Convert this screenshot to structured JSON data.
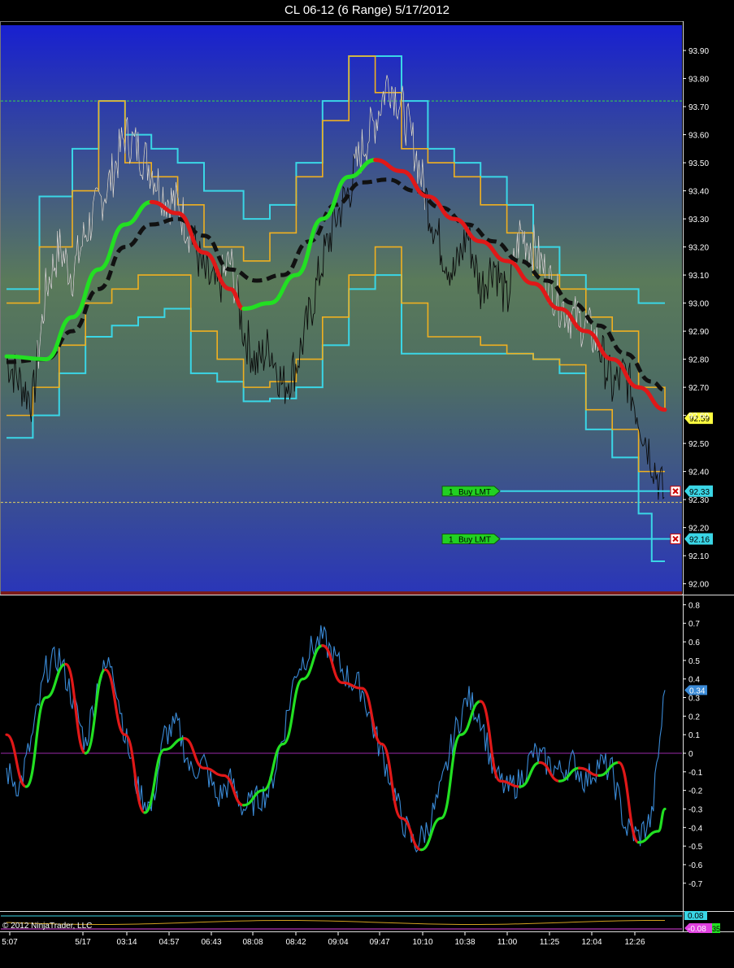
{
  "title": "CL 06-12 (6 Range)  5/17/2012",
  "copyright": "© 2012 NinjaTrader, LLC",
  "colors": {
    "price_bg_top": "#1a22c8",
    "price_bg_mid": "#5a7a5a",
    "price_bg_bottom": "#2a3aa8",
    "price_bars": "#0a0a0a",
    "price_bars_high": "#ffffff",
    "channel_outer": "#3ad6e6",
    "channel_inner": "#f0b020",
    "ma_up": "#22e022",
    "ma_down": "#e01818",
    "ma_slow": "#111111",
    "osc_fast": "#3a8ad6",
    "osc_up": "#22e022",
    "osc_down": "#e01818",
    "zero_line": "#9a2aa8",
    "order_line": "#3ad6e6",
    "order_tag": "#22d022",
    "last_price_tag": "#ffff40",
    "grid_text": "#ffffff"
  },
  "chart_data": [
    {
      "panel": "price",
      "type": "line",
      "instrument": "CL 06-12",
      "bar_type": "6 Range",
      "y_ticks": [
        "93.90",
        "93.80",
        "93.70",
        "93.60",
        "93.50",
        "93.40",
        "93.30",
        "93.20",
        "93.10",
        "93.00",
        "92.90",
        "92.80",
        "92.70",
        "92.60",
        "92.50",
        "92.40",
        "92.30",
        "92.20",
        "92.10",
        "92.00"
      ],
      "ylim": [
        91.97,
        93.99
      ],
      "reference_lines": [
        {
          "value": 93.72,
          "style": "dashed",
          "color": "#3ad64a"
        },
        {
          "value": 92.29,
          "style": "dashed",
          "color": "#e0d060"
        }
      ],
      "last_price": "92.59",
      "price_close": [
        [
          0,
          92.8
        ],
        [
          2,
          92.72
        ],
        [
          4,
          92.65
        ],
        [
          6,
          93.05
        ],
        [
          8,
          93.2
        ],
        [
          10,
          93.1
        ],
        [
          12,
          93.25
        ],
        [
          14,
          93.35
        ],
        [
          16,
          93.45
        ],
        [
          18,
          93.6
        ],
        [
          20,
          93.55
        ],
        [
          22,
          93.48
        ],
        [
          24,
          93.38
        ],
        [
          26,
          93.35
        ],
        [
          28,
          93.25
        ],
        [
          30,
          93.1
        ],
        [
          32,
          93.05
        ],
        [
          34,
          93.15
        ],
        [
          36,
          92.9
        ],
        [
          38,
          92.78
        ],
        [
          40,
          92.85
        ],
        [
          42,
          92.7
        ],
        [
          44,
          92.78
        ],
        [
          46,
          92.95
        ],
        [
          48,
          93.15
        ],
        [
          50,
          93.3
        ],
        [
          52,
          93.4
        ],
        [
          54,
          93.55
        ],
        [
          56,
          93.65
        ],
        [
          58,
          93.8
        ],
        [
          60,
          93.7
        ],
        [
          62,
          93.55
        ],
        [
          64,
          93.35
        ],
        [
          66,
          93.2
        ],
        [
          68,
          93.1
        ],
        [
          70,
          93.25
        ],
        [
          72,
          93.05
        ],
        [
          74,
          93.15
        ],
        [
          76,
          93.0
        ],
        [
          78,
          93.25
        ],
        [
          80,
          93.2
        ],
        [
          82,
          93.1
        ],
        [
          84,
          93.0
        ],
        [
          86,
          92.95
        ],
        [
          88,
          92.92
        ],
        [
          90,
          92.85
        ],
        [
          92,
          92.7
        ],
        [
          94,
          92.75
        ],
        [
          96,
          92.6
        ],
        [
          98,
          92.45
        ],
        [
          100,
          92.3
        ],
        [
          101,
          92.6
        ]
      ],
      "ma_fast": [
        [
          0,
          92.81
        ],
        [
          6,
          92.8
        ],
        [
          10,
          92.95
        ],
        [
          14,
          93.12
        ],
        [
          18,
          93.28
        ],
        [
          22,
          93.36
        ],
        [
          26,
          93.32
        ],
        [
          30,
          93.18
        ],
        [
          34,
          93.05
        ],
        [
          36,
          92.98
        ],
        [
          40,
          93.0
        ],
        [
          44,
          93.1
        ],
        [
          48,
          93.3
        ],
        [
          52,
          93.45
        ],
        [
          56,
          93.51
        ],
        [
          60,
          93.47
        ],
        [
          64,
          93.38
        ],
        [
          68,
          93.3
        ],
        [
          72,
          93.22
        ],
        [
          76,
          93.15
        ],
        [
          80,
          93.07
        ],
        [
          84,
          92.98
        ],
        [
          88,
          92.9
        ],
        [
          92,
          92.8
        ],
        [
          96,
          92.7
        ],
        [
          100,
          92.62
        ]
      ],
      "ma_fast_dir": [
        "down",
        "up",
        "up",
        "up",
        "up",
        "up",
        "down",
        "down",
        "down",
        "down",
        "up",
        "up",
        "up",
        "up",
        "up",
        "down",
        "down",
        "down",
        "down",
        "down",
        "down",
        "down",
        "down",
        "down",
        "down",
        "down"
      ],
      "ma_slow": [
        [
          0,
          92.79
        ],
        [
          6,
          92.8
        ],
        [
          10,
          92.9
        ],
        [
          14,
          93.05
        ],
        [
          18,
          93.2
        ],
        [
          22,
          93.28
        ],
        [
          26,
          93.3
        ],
        [
          30,
          93.24
        ],
        [
          34,
          93.12
        ],
        [
          38,
          93.08
        ],
        [
          42,
          93.1
        ],
        [
          46,
          93.22
        ],
        [
          50,
          93.35
        ],
        [
          54,
          93.43
        ],
        [
          58,
          93.44
        ],
        [
          62,
          93.4
        ],
        [
          66,
          93.34
        ],
        [
          70,
          93.28
        ],
        [
          74,
          93.22
        ],
        [
          78,
          93.15
        ],
        [
          82,
          93.08
        ],
        [
          86,
          93.0
        ],
        [
          90,
          92.92
        ],
        [
          94,
          92.82
        ],
        [
          98,
          92.72
        ],
        [
          100,
          92.69
        ]
      ],
      "channel_outer_upper": [
        [
          0,
          93.05
        ],
        [
          5,
          93.38
        ],
        [
          10,
          93.55
        ],
        [
          14,
          93.72
        ],
        [
          18,
          93.6
        ],
        [
          22,
          93.55
        ],
        [
          26,
          93.5
        ],
        [
          30,
          93.4
        ],
        [
          36,
          93.3
        ],
        [
          40,
          93.35
        ],
        [
          44,
          93.5
        ],
        [
          48,
          93.72
        ],
        [
          52,
          93.88
        ],
        [
          56,
          93.88
        ],
        [
          60,
          93.72
        ],
        [
          64,
          93.55
        ],
        [
          68,
          93.5
        ],
        [
          72,
          93.45
        ],
        [
          76,
          93.35
        ],
        [
          80,
          93.2
        ],
        [
          84,
          93.1
        ],
        [
          88,
          93.05
        ],
        [
          92,
          93.05
        ],
        [
          96,
          93.0
        ],
        [
          100,
          93.0
        ]
      ],
      "channel_outer_lower": [
        [
          0,
          92.52
        ],
        [
          4,
          92.6
        ],
        [
          8,
          92.75
        ],
        [
          12,
          92.88
        ],
        [
          16,
          92.92
        ],
        [
          20,
          92.95
        ],
        [
          24,
          92.98
        ],
        [
          28,
          92.75
        ],
        [
          32,
          92.72
        ],
        [
          36,
          92.65
        ],
        [
          40,
          92.66
        ],
        [
          44,
          92.7
        ],
        [
          48,
          92.85
        ],
        [
          52,
          93.05
        ],
        [
          56,
          93.1
        ],
        [
          60,
          92.82
        ],
        [
          64,
          92.82
        ],
        [
          68,
          92.82
        ],
        [
          72,
          92.82
        ],
        [
          76,
          92.82
        ],
        [
          80,
          92.8
        ],
        [
          84,
          92.75
        ],
        [
          88,
          92.55
        ],
        [
          92,
          92.45
        ],
        [
          96,
          92.25
        ],
        [
          98,
          92.08
        ],
        [
          100,
          92.08
        ]
      ],
      "channel_inner_upper": [
        [
          0,
          93.0
        ],
        [
          5,
          93.2
        ],
        [
          10,
          93.4
        ],
        [
          14,
          93.72
        ],
        [
          18,
          93.5
        ],
        [
          22,
          93.45
        ],
        [
          26,
          93.35
        ],
        [
          30,
          93.2
        ],
        [
          36,
          93.15
        ],
        [
          40,
          93.25
        ],
        [
          44,
          93.45
        ],
        [
          48,
          93.65
        ],
        [
          52,
          93.88
        ],
        [
          56,
          93.75
        ],
        [
          60,
          93.55
        ],
        [
          64,
          93.5
        ],
        [
          68,
          93.45
        ],
        [
          72,
          93.35
        ],
        [
          76,
          93.25
        ],
        [
          80,
          93.1
        ],
        [
          84,
          93.05
        ],
        [
          88,
          92.95
        ],
        [
          92,
          92.9
        ],
        [
          96,
          92.7
        ],
        [
          100,
          92.62
        ]
      ],
      "channel_inner_lower": [
        [
          0,
          92.6
        ],
        [
          4,
          92.7
        ],
        [
          8,
          92.85
        ],
        [
          12,
          93.0
        ],
        [
          16,
          93.05
        ],
        [
          20,
          93.1
        ],
        [
          24,
          93.1
        ],
        [
          28,
          92.9
        ],
        [
          32,
          92.8
        ],
        [
          36,
          92.7
        ],
        [
          40,
          92.72
        ],
        [
          44,
          92.8
        ],
        [
          48,
          92.95
        ],
        [
          52,
          93.1
        ],
        [
          56,
          93.2
        ],
        [
          60,
          93.0
        ],
        [
          64,
          92.88
        ],
        [
          68,
          92.88
        ],
        [
          72,
          92.85
        ],
        [
          76,
          92.82
        ],
        [
          80,
          92.8
        ],
        [
          84,
          92.78
        ],
        [
          88,
          92.62
        ],
        [
          92,
          92.55
        ],
        [
          96,
          92.4
        ],
        [
          100,
          92.4
        ]
      ],
      "orders": [
        {
          "qty": "1",
          "label": "Buy LMT",
          "price": 92.33,
          "price_label": "92.33"
        },
        {
          "qty": "1",
          "label": "Buy LMT",
          "price": 92.16,
          "price_label": "92.16"
        }
      ]
    },
    {
      "panel": "oscillator",
      "type": "line",
      "y_ticks": [
        "0.8",
        "0.7",
        "0.6",
        "0.5",
        "0.4",
        "0.3",
        "0.2",
        "0.1",
        "0",
        "-0.1",
        "-0.2",
        "-0.3",
        "-0.4",
        "-0.5",
        "-0.6",
        "-0.7"
      ],
      "ylim": [
        -0.85,
        0.85
      ],
      "last_value": "0.34",
      "fast": [
        [
          0,
          -0.1
        ],
        [
          2,
          -0.18
        ],
        [
          4,
          0.1
        ],
        [
          6,
          0.45
        ],
        [
          8,
          0.52
        ],
        [
          10,
          0.3
        ],
        [
          12,
          0.05
        ],
        [
          14,
          0.4
        ],
        [
          16,
          0.5
        ],
        [
          18,
          0.1
        ],
        [
          20,
          -0.2
        ],
        [
          22,
          -0.3
        ],
        [
          24,
          0.1
        ],
        [
          26,
          0.15
        ],
        [
          28,
          -0.1
        ],
        [
          30,
          -0.05
        ],
        [
          32,
          -0.25
        ],
        [
          34,
          -0.15
        ],
        [
          36,
          -0.3
        ],
        [
          38,
          -0.25
        ],
        [
          40,
          -0.2
        ],
        [
          42,
          0.1
        ],
        [
          44,
          0.45
        ],
        [
          46,
          0.55
        ],
        [
          48,
          0.62
        ],
        [
          50,
          0.5
        ],
        [
          52,
          0.4
        ],
        [
          54,
          0.35
        ],
        [
          56,
          0.1
        ],
        [
          58,
          -0.1
        ],
        [
          60,
          -0.35
        ],
        [
          62,
          -0.5
        ],
        [
          64,
          -0.4
        ],
        [
          66,
          -0.2
        ],
        [
          68,
          0.1
        ],
        [
          70,
          0.3
        ],
        [
          72,
          0.2
        ],
        [
          74,
          -0.1
        ],
        [
          76,
          -0.2
        ],
        [
          78,
          -0.15
        ],
        [
          80,
          0.0
        ],
        [
          82,
          -0.05
        ],
        [
          84,
          -0.1
        ],
        [
          86,
          -0.05
        ],
        [
          88,
          -0.15
        ],
        [
          90,
          -0.05
        ],
        [
          92,
          -0.1
        ],
        [
          94,
          -0.4
        ],
        [
          96,
          -0.45
        ],
        [
          98,
          -0.35
        ],
        [
          100,
          0.34
        ]
      ],
      "signal": [
        [
          0,
          0.1
        ],
        [
          3,
          -0.18
        ],
        [
          6,
          0.3
        ],
        [
          9,
          0.48
        ],
        [
          12,
          0.0
        ],
        [
          15,
          0.45
        ],
        [
          18,
          0.1
        ],
        [
          21,
          -0.32
        ],
        [
          24,
          0.02
        ],
        [
          27,
          0.08
        ],
        [
          30,
          -0.08
        ],
        [
          33,
          -0.12
        ],
        [
          36,
          -0.28
        ],
        [
          39,
          -0.2
        ],
        [
          42,
          0.05
        ],
        [
          45,
          0.4
        ],
        [
          48,
          0.58
        ],
        [
          51,
          0.38
        ],
        [
          54,
          0.35
        ],
        [
          57,
          0.05
        ],
        [
          60,
          -0.35
        ],
        [
          63,
          -0.52
        ],
        [
          66,
          -0.35
        ],
        [
          69,
          0.1
        ],
        [
          72,
          0.28
        ],
        [
          75,
          -0.15
        ],
        [
          78,
          -0.18
        ],
        [
          81,
          -0.05
        ],
        [
          84,
          -0.15
        ],
        [
          87,
          -0.08
        ],
        [
          90,
          -0.12
        ],
        [
          93,
          -0.05
        ],
        [
          96,
          -0.48
        ],
        [
          99,
          -0.42
        ],
        [
          100,
          -0.3
        ]
      ],
      "signal_dir": [
        "down",
        "down",
        "up",
        "up",
        "down",
        "up",
        "down",
        "down",
        "up",
        "up",
        "down",
        "down",
        "down",
        "up",
        "up",
        "up",
        "up",
        "down",
        "down",
        "down",
        "down",
        "down",
        "up",
        "up",
        "up",
        "down",
        "down",
        "up",
        "down",
        "up",
        "down",
        "up",
        "down",
        "up",
        "up"
      ]
    },
    {
      "panel": "lower",
      "type": "line",
      "values_label": [
        "0.08",
        "-0.08"
      ],
      "last_value_extra": "35"
    }
  ],
  "x_axis": {
    "ticks": [
      "5:07",
      "5/17",
      "03:14",
      "04:57",
      "06:43",
      "08:08",
      "08:42",
      "09:04",
      "09:47",
      "10:10",
      "10:38",
      "11:00",
      "11:25",
      "12:04",
      "12:26"
    ]
  }
}
